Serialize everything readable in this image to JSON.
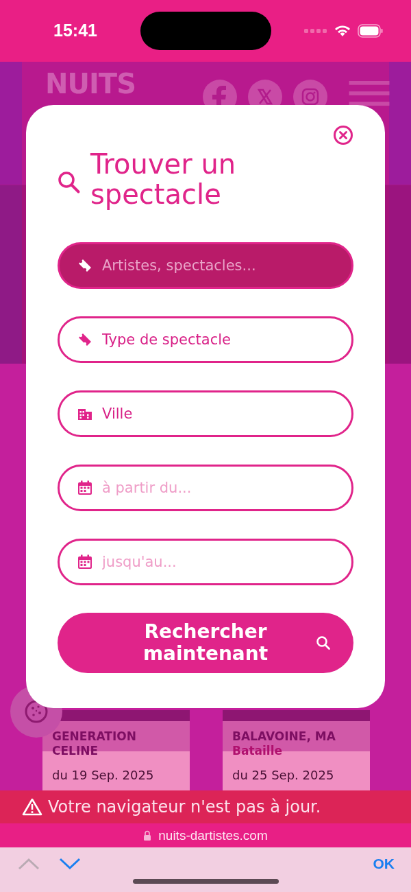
{
  "status_bar": {
    "time": "15:41"
  },
  "site_header": {
    "logo": "NUITS"
  },
  "search_modal": {
    "title": "Trouver un spectacle",
    "fields": [
      {
        "kind": "ticket",
        "placeholder": "Artistes, spectacles...",
        "focused": true
      },
      {
        "kind": "ticket",
        "value": "Type de spectacle",
        "focused": false
      },
      {
        "kind": "building",
        "value": "Ville",
        "focused": false
      },
      {
        "kind": "calendar",
        "placeholder": "à partir du...",
        "focused": false
      },
      {
        "kind": "calendar",
        "placeholder": "jusqu'au...",
        "focused": false
      }
    ],
    "submit": "Rechercher maintenant"
  },
  "cards": [
    {
      "title": "GENERATION CELINE",
      "date": "du 19 Sep. 2025"
    },
    {
      "title": "BALAVOINE, MA",
      "subtitle": "Bataille",
      "date": "du 25 Sep. 2025"
    }
  ],
  "warning": "Votre navigateur n'est pas à jour.",
  "url": "nuits-dartistes.com",
  "keyboard_bar": {
    "previous_disabled": true,
    "next_disabled": false,
    "done": "OK"
  }
}
